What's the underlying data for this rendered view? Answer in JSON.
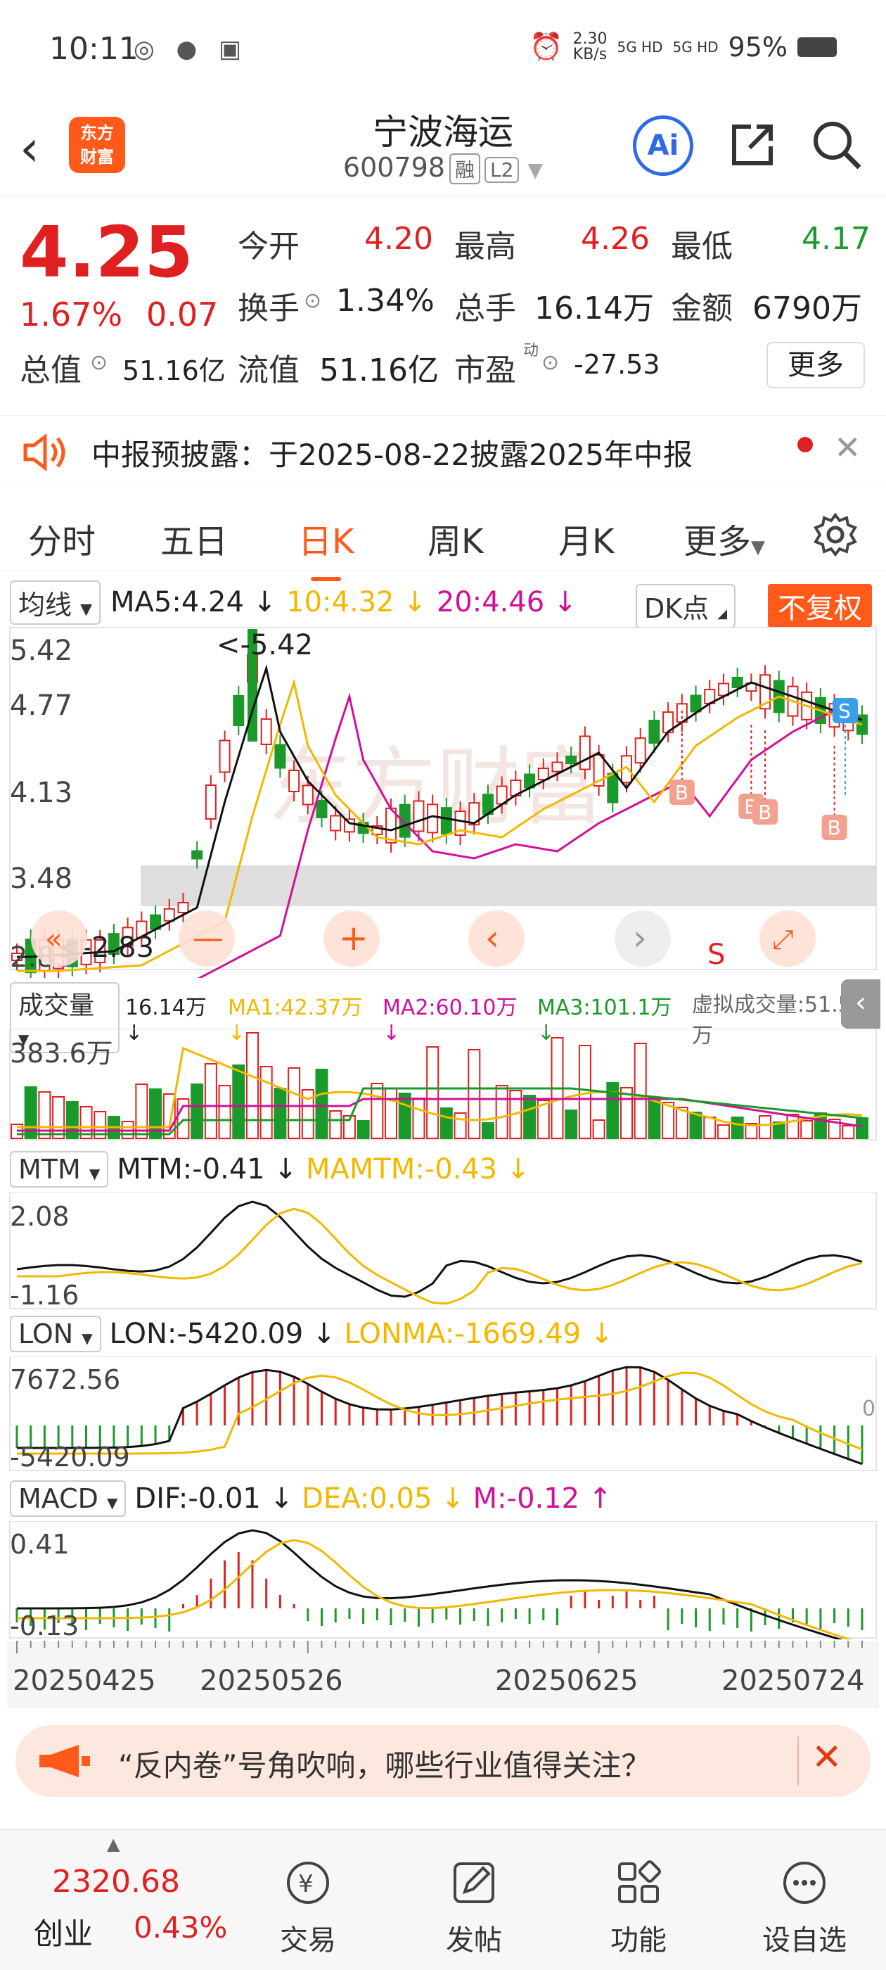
{
  "status": {
    "time": "10:11",
    "net": "2.30",
    "net_unit": "KB/s",
    "sig1": "5G HD",
    "sig2": "5G HD",
    "battery": "95%"
  },
  "header": {
    "logo_line1": "东方",
    "logo_line2": "财富",
    "title": "宁波海运",
    "code": "600798",
    "tag1": "融",
    "tag2": "L2",
    "ai": "Ai"
  },
  "quote": {
    "price": "4.25",
    "pct": "1.67%",
    "change": "0.07",
    "open_label": "今开",
    "open": "4.20",
    "high_label": "最高",
    "high": "4.26",
    "low_label": "最低",
    "low": "4.17",
    "turnover_label": "换手",
    "turnover": "1.34%",
    "volume_label": "总手",
    "volume": "16.14万",
    "amount_label": "金额",
    "amount": "6790万",
    "mktcap_label": "总值",
    "mktcap": "51.16亿",
    "float_label": "流值",
    "float": "51.16亿",
    "pe_label": "市盈",
    "pe_sup": "动",
    "pe": "-27.53",
    "more": "更多"
  },
  "notice": {
    "text": "中报预披露：于2025-08-22披露2025年中报"
  },
  "tabs": [
    "分时",
    "五日",
    "日K",
    "周K",
    "月K",
    "更多"
  ],
  "kline": {
    "ma_label": "均线",
    "ma5": "MA5:4.24",
    "ma10": "10:4.32",
    "ma20": "20:4.46",
    "dk": "DK点",
    "fq": "不复权",
    "axis": [
      "5.42",
      "4.77",
      "4.13",
      "3.48",
      "2.83"
    ],
    "max_note": "<-5.42",
    "min_note": "<-2.83",
    "signal_b": "B",
    "signal_s": "S"
  },
  "volume": {
    "label": "成交量",
    "vol": "16.14万",
    "ma1": "MA1:42.37万",
    "ma2": "MA2:60.10万",
    "ma3": "MA3:101.1万",
    "virtual": "虚拟成交量:51.51万",
    "axis_top": "383.6万"
  },
  "mtm": {
    "label": "MTM",
    "mtm": "MTM:-0.41",
    "mamtm": "MAMTM:-0.43",
    "axis_top": "2.08",
    "axis_bottom": "-1.16"
  },
  "lon": {
    "label": "LON",
    "lon": "LON:-5420.09",
    "lonma": "LONMA:-1669.49",
    "axis_top": "7672.56",
    "axis_bottom": "-5420.09",
    "zero": "0"
  },
  "macd": {
    "label": "MACD",
    "dif": "DIF:-0.01",
    "dea": "DEA:0.05",
    "m": "M:-0.12",
    "axis_top": "0.41",
    "axis_bottom": "-0.13"
  },
  "dates": [
    "20250425",
    "20250526",
    "20250625",
    "20250724"
  ],
  "promo": {
    "text": "“反内卷”号角吹响，哪些行业值得关注？"
  },
  "bottom_nav": {
    "index_value": "2320.68",
    "index_name": "创业",
    "index_pct": "0.43%",
    "trade": "交易",
    "post": "发帖",
    "func": "功能",
    "watch": "设自选"
  },
  "colors": {
    "up": "#e02020",
    "down": "#1a9a2a",
    "accent": "#ff5a1a",
    "ma10": "#f2b800",
    "ma20": "#d0109a"
  }
}
